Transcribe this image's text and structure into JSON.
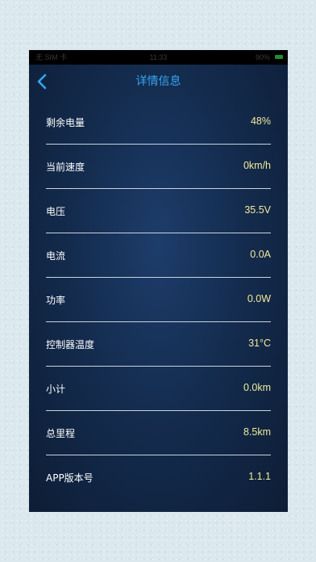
{
  "status_bar": {
    "carrier": "无 SIM 卡",
    "time": "11:33",
    "battery": "90%"
  },
  "nav": {
    "back_icon": "chevron-left-icon",
    "title": "详情信息",
    "accent_color": "#35a6f2"
  },
  "rows": [
    {
      "label": "剩余电量",
      "value": "48%"
    },
    {
      "label": "当前速度",
      "value": "0km/h"
    },
    {
      "label": "电压",
      "value": "35.5V"
    },
    {
      "label": "电流",
      "value": "0.0A"
    },
    {
      "label": "功率",
      "value": "0.0W"
    },
    {
      "label": "控制器温度",
      "value": "31°C"
    },
    {
      "label": "小计",
      "value": "0.0km"
    },
    {
      "label": "总里程",
      "value": "8.5km"
    },
    {
      "label": "APP版本号",
      "value": "1.1.1"
    }
  ],
  "colors": {
    "value_text": "#f2ea9a",
    "label_text": "#ffffff",
    "divider": "#c9d3df"
  }
}
